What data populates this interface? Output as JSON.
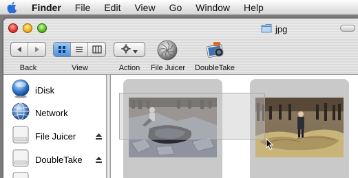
{
  "menubar": {
    "app": "Finder",
    "items": [
      "File",
      "Edit",
      "View",
      "Go",
      "Window",
      "Help"
    ]
  },
  "window": {
    "title": "jpg"
  },
  "toolbar": {
    "back_label": "Back",
    "view_label": "View",
    "action_label": "Action",
    "filejuicer_label": "File Juicer",
    "doubletake_label": "DoubleTake"
  },
  "sidebar": {
    "items": [
      {
        "label": "iDisk",
        "icon": "idisk-icon"
      },
      {
        "label": "Network",
        "icon": "network-globe-icon"
      },
      {
        "label": "File Juicer",
        "icon": "disk-drive-icon",
        "eject": true
      },
      {
        "label": "DoubleTake",
        "icon": "disk-drive-icon",
        "eject": true
      }
    ]
  },
  "content": {
    "thumbnails": [
      {
        "subject": "3D street chalk art crevasse photo"
      },
      {
        "subject": "3D street chalk art rock photo"
      }
    ]
  },
  "colors": {
    "selected_view": "#4d93e0",
    "close": "#e2382f",
    "minimize": "#f3b21b",
    "zoom": "#5fc12a"
  }
}
